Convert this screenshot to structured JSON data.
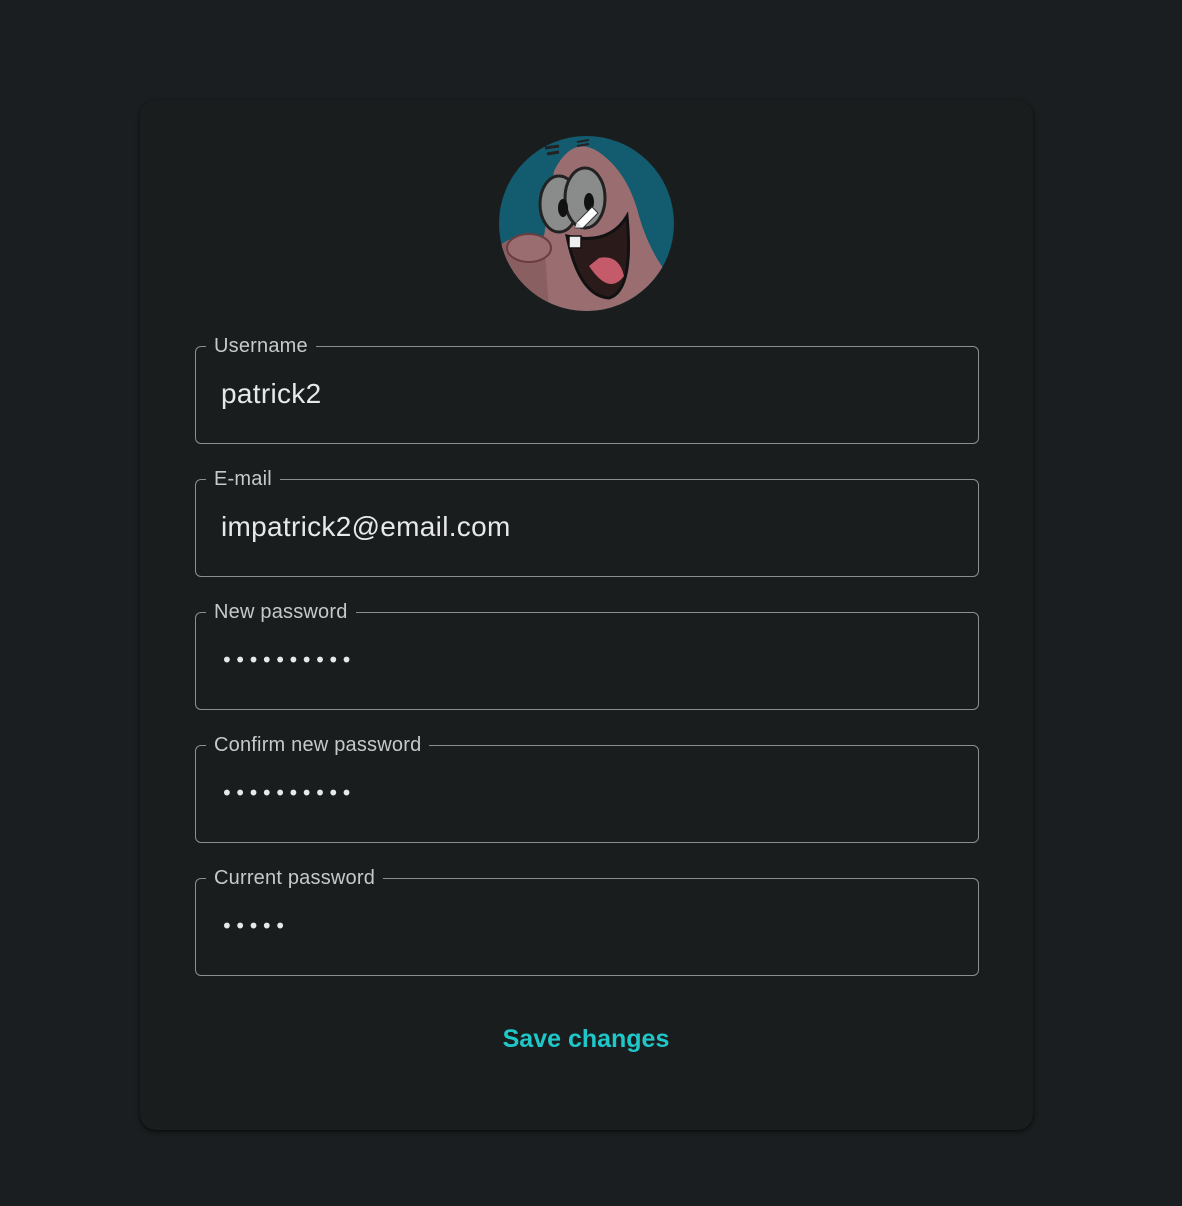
{
  "profile": {
    "avatar": {
      "alt_icon": "patrick-star-avatar",
      "edit_icon": "pencil-icon",
      "bg_color": "#135b6e"
    },
    "fields": {
      "username": {
        "label": "Username",
        "value": "patrick2"
      },
      "email": {
        "label": "E-mail",
        "value": "impatrick2@email.com"
      },
      "new_password": {
        "label": "New password",
        "value": "••••••••••"
      },
      "confirm_password": {
        "label": "Confirm new password",
        "value": "••••••••••"
      },
      "current_password": {
        "label": "Current password",
        "value": "•••••"
      }
    },
    "save_label": "Save changes",
    "accent_color": "#1fc7c9"
  }
}
